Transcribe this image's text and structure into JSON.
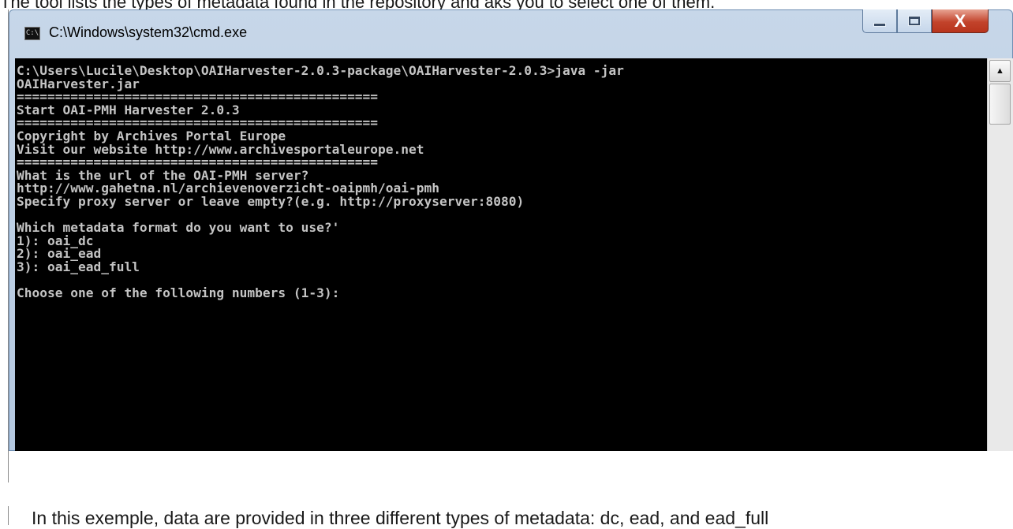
{
  "document": {
    "top_text": "The tool lists the types of metadata found in the repository and aks you to select one of them.",
    "bottom_text": "In this exemple, data are provided in three different types of metadata: dc, ead, and ead_full"
  },
  "window": {
    "title": "C:\\Windows\\system32\\cmd.exe",
    "icon_text": "C:\\",
    "icon": "cmd-icon",
    "controls": {
      "minimize": "minimize-icon",
      "maximize": "maximize-icon",
      "close": "X"
    }
  },
  "console": {
    "lines": [
      "C:\\Users\\Lucile\\Desktop\\OAIHarvester-2.0.3-package\\OAIHarvester-2.0.3>java -jar",
      "OAIHarvester.jar",
      "===============================================",
      "Start OAI-PMH Harvester 2.0.3",
      "===============================================",
      "Copyright by Archives Portal Europe",
      "Visit our website http://www.archivesportaleurope.net",
      "===============================================",
      "What is the url of the OAI-PMH server?",
      "http://www.gahetna.nl/archievenoverzicht-oaipmh/oai-pmh",
      "Specify proxy server or leave empty?(e.g. http://proxyserver:8080)",
      "",
      "Which metadata format do you want to use?'",
      "1): oai_dc",
      "2): oai_ead",
      "3): oai_ead_full",
      "",
      "Choose one of the following numbers (1-3):"
    ]
  },
  "scrollbar": {
    "up_arrow": "▲"
  }
}
